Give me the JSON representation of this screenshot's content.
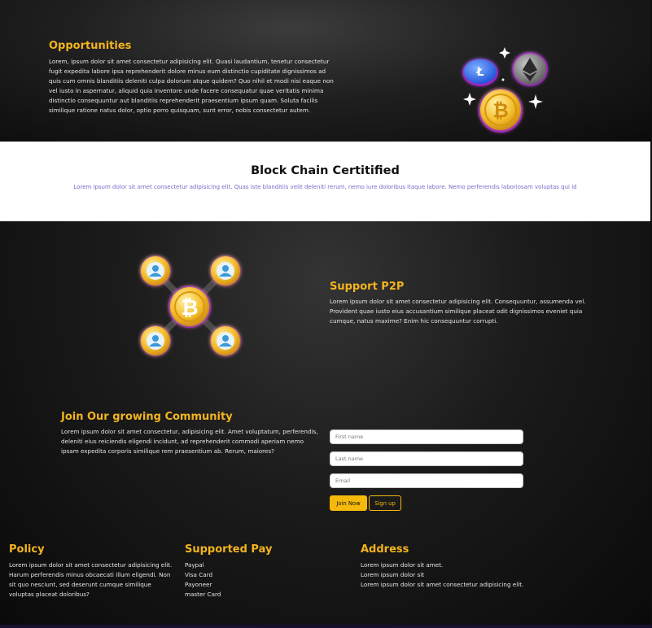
{
  "opportunities": {
    "title": "Opportunities",
    "text": "Lorem, ipsum dolor sit amet consectetur adipisicing elit. Quasi laudantium, tenetur consectetur fugit expedita labore ipsa reprehenderit dolore minus eum distinctio cupiditate dignissimos ad quis cum omnis blanditiis deleniti culpa dolorum atque quidem? Quo nihil et modi nisi eaque non vel iusto in aspernatur, aliquid quia inventore unde facere consequatur quae veritatis minima distinctio consequuntur aut blanditiis reprehenderit praesentium ipsum quam. Soluta facilis similique ratione natus dolor, optio porro quisquam, sunt error, nobis consectetur autem."
  },
  "certified": {
    "title": "Block Chain Certitified",
    "text": "Lorem ipsum dolor sit amet consectetur adipisicing elit. Quas iste blanditiis velit deleniti rerum, nemo iure doloribus itaque labore. Nemo perferendis laboriosam voluptas qui id"
  },
  "support": {
    "title": "Support P2P",
    "text": "Lorem ipsum dolor sit amet consectetur adipisicing elit. Consequuntur, assumenda vel. Provident quae iusto eius accusantium similique placeat odit dignissimos eveniet quia cumque, natus maxime? Enim hic consequuntur corrupti."
  },
  "community": {
    "title": "Join Our growing Community",
    "text": "Lorem ipsum dolor sit amet consectetur, adipisicing elit. Amet voluptatum, perferendis, deleniti eius reiciendis eligendi incidunt, ad reprehenderit commodi aperiam nemo ipsam expedita corporis similique rem praesentium ab. Rerum, maiores?"
  },
  "form": {
    "first_name_placeholder": "First name",
    "last_name_placeholder": "Last name",
    "email_placeholder": "Email",
    "join_label": "Join Now",
    "signup_label": "Sign up"
  },
  "footer": {
    "policy_title": "Policy",
    "policy_text": "Lorem ipsum dolor sit amet consectetur adipisicing elit. Harum perferendis minus obcaecati illum eligendi. Non sit quo nesciunt, sed deserunt cumque similique voluptas placeat doloribus?",
    "pay_title": "Supported Pay",
    "pay_items": [
      "Paypal",
      "Visa Card",
      "Payoneer",
      "master Card"
    ],
    "address_title": "Address",
    "address_lines": [
      "Lorem ipsum dolor sit amet.",
      "Lorem ipsum dolor sit",
      "Lorem ipsum dolor sit amet consectetur adipisicing elit."
    ]
  },
  "colors": {
    "accent_gold": "#f3b41e",
    "button_yellow": "#f5b90c",
    "glow_purple": "#b01fd0"
  },
  "icons": {
    "coins_art": "crypto-coins-illustration",
    "network_art": "bitcoin-network-illustration"
  }
}
